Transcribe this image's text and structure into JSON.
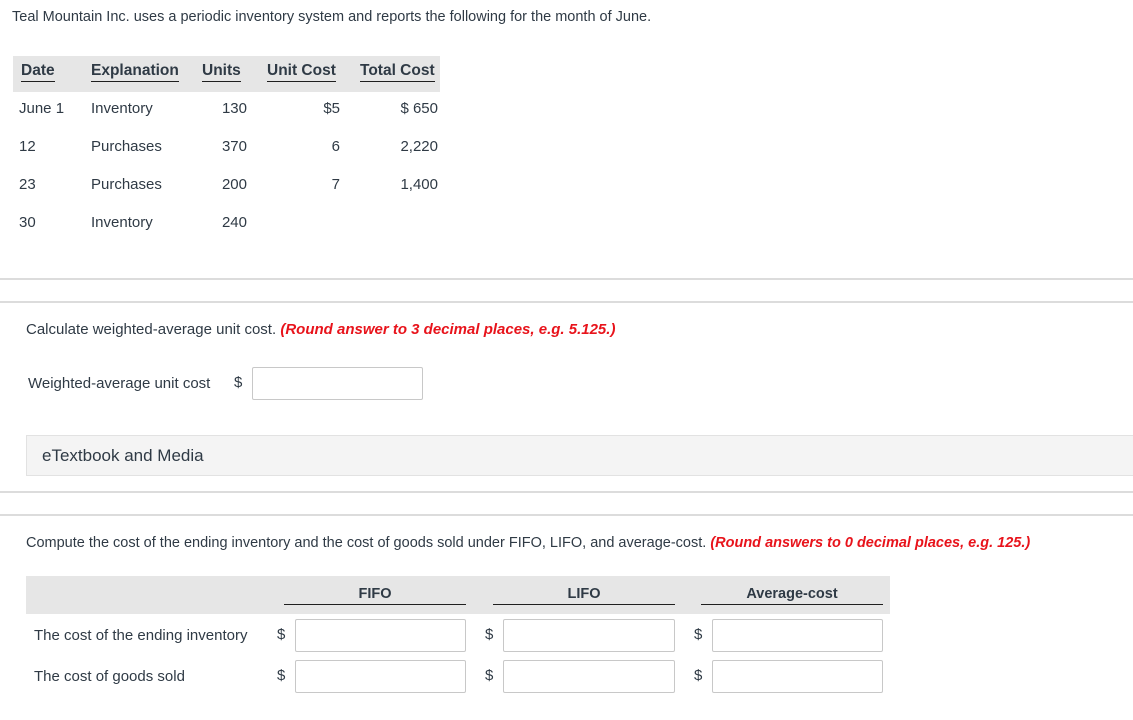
{
  "intro": "Teal Mountain Inc. uses a periodic inventory system and reports the following for the month of June.",
  "inventory_table": {
    "headers": [
      "Date",
      "Explanation",
      "Units",
      "Unit Cost",
      "Total Cost"
    ],
    "rows": [
      {
        "date": "June 1",
        "explanation": "Inventory",
        "units": "130",
        "unit_cost": "$5",
        "total_cost": "$ 650"
      },
      {
        "date": "12",
        "explanation": "Purchases",
        "units": "370",
        "unit_cost": "6",
        "total_cost": "2,220"
      },
      {
        "date": "23",
        "explanation": "Purchases",
        "units": "200",
        "unit_cost": "7",
        "total_cost": "1,400"
      },
      {
        "date": "30",
        "explanation": "Inventory",
        "units": "240",
        "unit_cost": "",
        "total_cost": ""
      }
    ]
  },
  "part1": {
    "prompt": "Calculate weighted-average unit cost.",
    "hint": "(Round answer to 3 decimal places, e.g. 5.125.)",
    "field_label": "Weighted-average unit cost",
    "currency": "$",
    "value": ""
  },
  "etextbook": {
    "label": "eTextbook and Media"
  },
  "part2": {
    "prompt": "Compute the cost of the ending inventory and the cost of goods sold under FIFO, LIFO, and average-cost.",
    "hint": "(Round answers to 0 decimal places, e.g. 125.)",
    "columns": [
      "FIFO",
      "LIFO",
      "Average-cost"
    ],
    "rows": [
      {
        "label": "The cost of the ending inventory",
        "currency": "$",
        "values": [
          "",
          "",
          ""
        ]
      },
      {
        "label": "The cost of goods sold",
        "currency": "$",
        "values": [
          "",
          "",
          ""
        ]
      }
    ]
  }
}
